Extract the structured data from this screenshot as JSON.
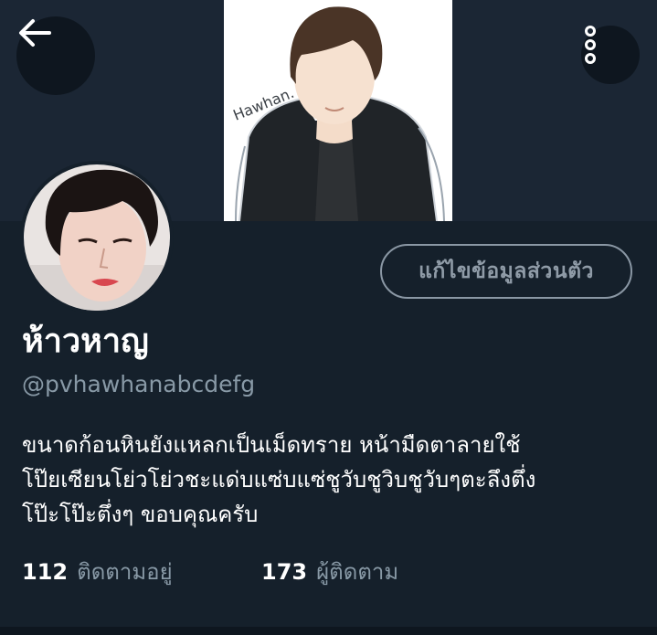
{
  "header": {
    "back_icon": "arrow-left-icon",
    "more_icon": "more-vertical-icon",
    "banner_signature": "Hawhan."
  },
  "profile": {
    "display_name": "ห้าวหาญ",
    "handle": "@pvhawhanabcdefg",
    "edit_button_label": "แก้ไขข้อมูลส่วนตัว",
    "bio_lines": [
      "ขนาดก้อนหินยังแหลกเป็นเม็ดทราย หน้ามืดตาลายใช้",
      "โป๊ยเซียนโย่วโย่วชะแด่บแซ่บแซ่ชูวับชูวิบชูวับๆตะลึงตึ่ง",
      "โป๊ะโป๊ะตึ่งๆ ขอบคุณครับ"
    ]
  },
  "stats": {
    "following_count": "112",
    "following_label": "ติดตามอยู่",
    "followers_count": "173",
    "followers_label": "ผู้ติดตาม"
  },
  "colors": {
    "background": "#15202b",
    "secondary_text": "#8899a6",
    "primary_text": "#ffffff"
  }
}
